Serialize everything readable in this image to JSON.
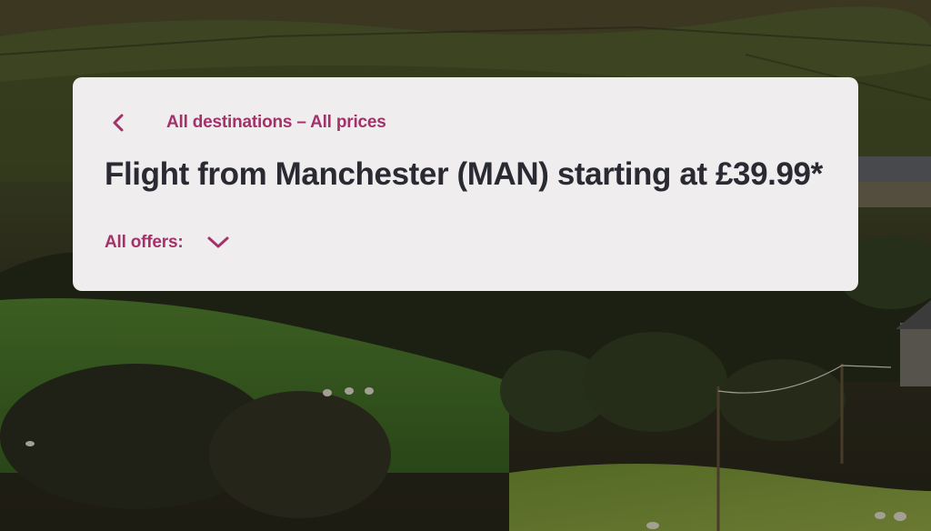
{
  "hero": {
    "background_image": "countryside-landscape",
    "overlay_color": "#2a2418"
  },
  "card": {
    "back_link": {
      "icon": "chevron-left-icon",
      "label": "All destinations – All prices"
    },
    "title": "Flight from Manchester (MAN) starting at £39.99*",
    "offers": {
      "label": "All offers:",
      "icon": "chevron-down-icon"
    }
  },
  "colors": {
    "accent": "#a3326a",
    "title_text": "#2a2a33",
    "card_background": "#efedee"
  }
}
